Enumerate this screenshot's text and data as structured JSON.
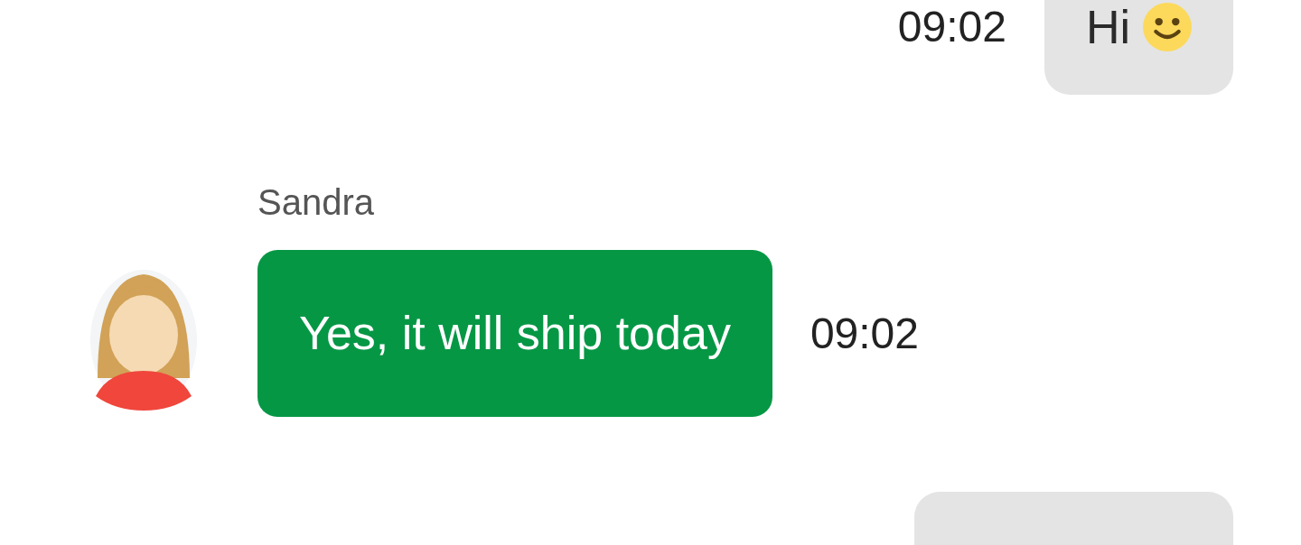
{
  "messages": [
    {
      "kind": "outgoing",
      "text": "Hi",
      "smiley": true,
      "time": "09:02"
    },
    {
      "kind": "incoming",
      "sender": "Sandra",
      "text": "Yes, it will ship today",
      "time": "09:02"
    },
    {
      "kind": "outgoing"
    }
  ]
}
